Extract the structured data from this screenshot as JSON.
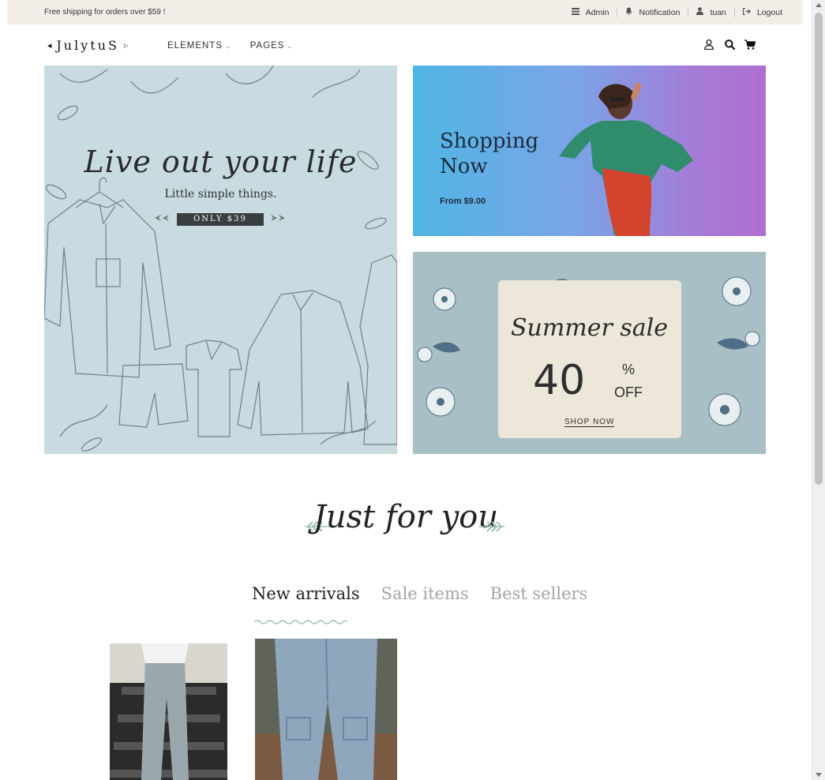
{
  "topbar": {
    "promo": "Free shipping for orders over $59 !",
    "links": [
      {
        "label": "Admin",
        "icon": "admin-icon"
      },
      {
        "label": "Notification",
        "icon": "bell-icon"
      },
      {
        "label": "tuan",
        "icon": "user-icon"
      },
      {
        "label": "Logout",
        "icon": "logout-icon"
      }
    ]
  },
  "header": {
    "logo": "JulytuS",
    "nav": [
      {
        "label": "ELEMENTS"
      },
      {
        "label": "PAGES"
      }
    ],
    "icons": [
      "account-icon",
      "search-icon",
      "cart-icon"
    ]
  },
  "hero": {
    "left": {
      "subtitle": "Little simple things.",
      "script": "Live out your life",
      "price_tag": "ONLY $39"
    },
    "top_right": {
      "title": "Shopping Now",
      "from": "From $9.00"
    },
    "bottom_right": {
      "title": "Summer sale",
      "percent": "40",
      "percent_sign": "%",
      "off": "OFF",
      "cta": "SHOP NOW"
    }
  },
  "section": {
    "title": "Just for you",
    "tabs": [
      {
        "label": "New arrivals",
        "active": true
      },
      {
        "label": "Sale items",
        "active": false
      },
      {
        "label": "Best sellers",
        "active": false
      }
    ]
  },
  "colors": {
    "topbar_bg": "#f4eee9",
    "accent_leaf": "#9cc2b4",
    "tab_inactive": "#a5a5a5"
  }
}
